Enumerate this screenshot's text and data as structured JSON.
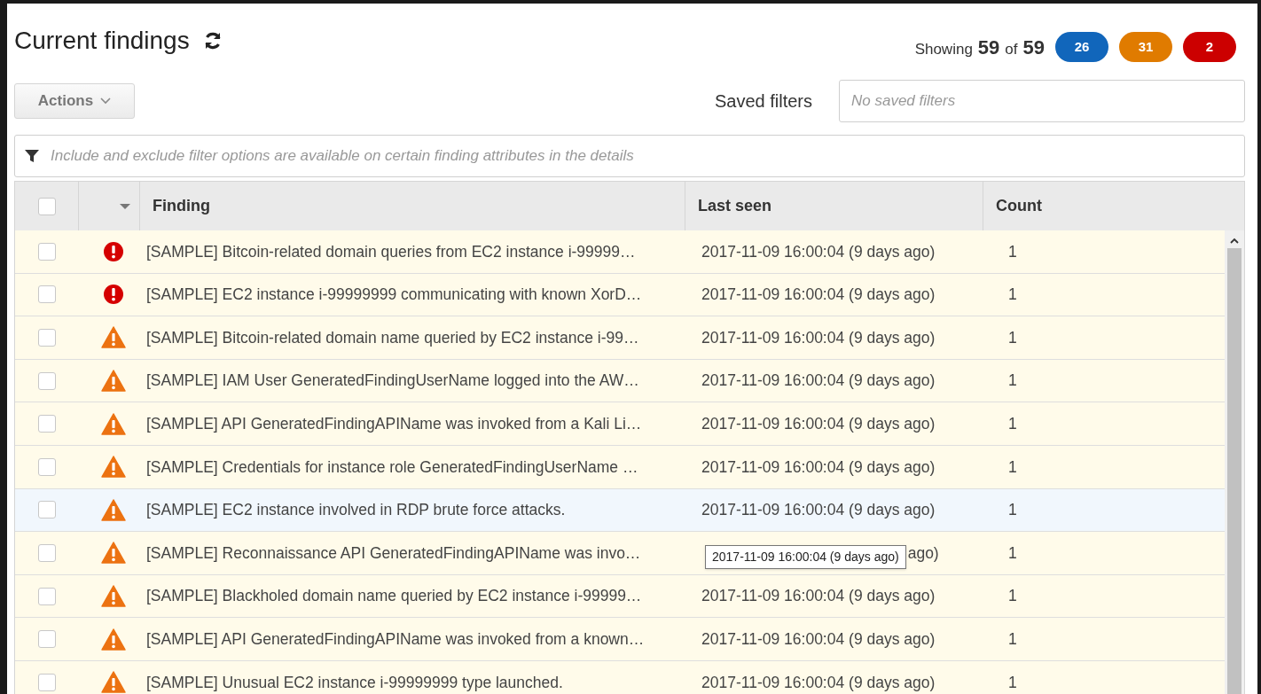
{
  "title": "Current findings",
  "summary": {
    "showing_label": "Showing",
    "shown": "59",
    "of_label": "of",
    "total": "59"
  },
  "severity_counts": [
    {
      "label": "26",
      "color": "#1166bb"
    },
    {
      "label": "31",
      "color": "#e07b00"
    },
    {
      "label": "2",
      "color": "#cc0000"
    }
  ],
  "actions_button": "Actions",
  "saved_filters": {
    "label": "Saved filters",
    "placeholder": "No saved filters"
  },
  "filter_bar": {
    "placeholder": "Include and exclude filter options are available on certain finding attributes in the details"
  },
  "table": {
    "columns": [
      "Finding",
      "Last seen",
      "Count"
    ],
    "header_checked": false,
    "rows": [
      {
        "checked": false,
        "highlighted": false,
        "kind": "high",
        "finding": "[SAMPLE] Bitcoin-related domain queries from EC2 instance i-99999…",
        "last_seen": "2017-11-09 16:00:04 (9 days ago)",
        "count": "1"
      },
      {
        "checked": false,
        "highlighted": false,
        "kind": "high",
        "finding": "[SAMPLE] EC2 instance i-99999999 communicating with known XorD…",
        "last_seen": "2017-11-09 16:00:04 (9 days ago)",
        "count": "1"
      },
      {
        "checked": false,
        "highlighted": false,
        "kind": "medium",
        "finding": "[SAMPLE] Bitcoin-related domain name queried by EC2 instance i-99…",
        "last_seen": "2017-11-09 16:00:04 (9 days ago)",
        "count": "1"
      },
      {
        "checked": false,
        "highlighted": false,
        "kind": "medium",
        "finding": "[SAMPLE] IAM User GeneratedFindingUserName logged into the AW…",
        "last_seen": "2017-11-09 16:00:04 (9 days ago)",
        "count": "1"
      },
      {
        "checked": false,
        "highlighted": false,
        "kind": "medium",
        "finding": "[SAMPLE] API GeneratedFindingAPIName was invoked from a Kali Li…",
        "last_seen": "2017-11-09 16:00:04 (9 days ago)",
        "count": "1"
      },
      {
        "checked": false,
        "highlighted": false,
        "kind": "medium",
        "finding": "[SAMPLE] Credentials for instance role GeneratedFindingUserName …",
        "last_seen": "2017-11-09 16:00:04 (9 days ago)",
        "count": "1"
      },
      {
        "checked": false,
        "highlighted": true,
        "kind": "medium",
        "finding": "[SAMPLE] EC2 instance involved in RDP brute force attacks.",
        "last_seen": "2017-11-09 16:00:04 (9 days ago)",
        "count": "1"
      },
      {
        "checked": false,
        "highlighted": false,
        "kind": "medium",
        "finding": "[SAMPLE] Reconnaissance API GeneratedFindingAPIName was invo…",
        "last_seen": "ago)",
        "tooltip": "2017-11-09 16:00:04 (9 days ago)",
        "count": "1"
      },
      {
        "checked": false,
        "highlighted": false,
        "kind": "medium",
        "finding": "[SAMPLE] Blackholed domain name queried by EC2 instance i-99999…",
        "last_seen": "2017-11-09 16:00:04 (9 days ago)",
        "count": "1"
      },
      {
        "checked": false,
        "highlighted": false,
        "kind": "medium",
        "finding": "[SAMPLE] API GeneratedFindingAPIName was invoked from a known…",
        "last_seen": "2017-11-09 16:00:04 (9 days ago)",
        "count": "1"
      },
      {
        "checked": false,
        "highlighted": false,
        "kind": "medium",
        "finding": "[SAMPLE] Unusual EC2 instance i-99999999 type launched.",
        "last_seen": "2017-11-09 16:00:04 (9 days ago)",
        "count": "1"
      }
    ]
  }
}
